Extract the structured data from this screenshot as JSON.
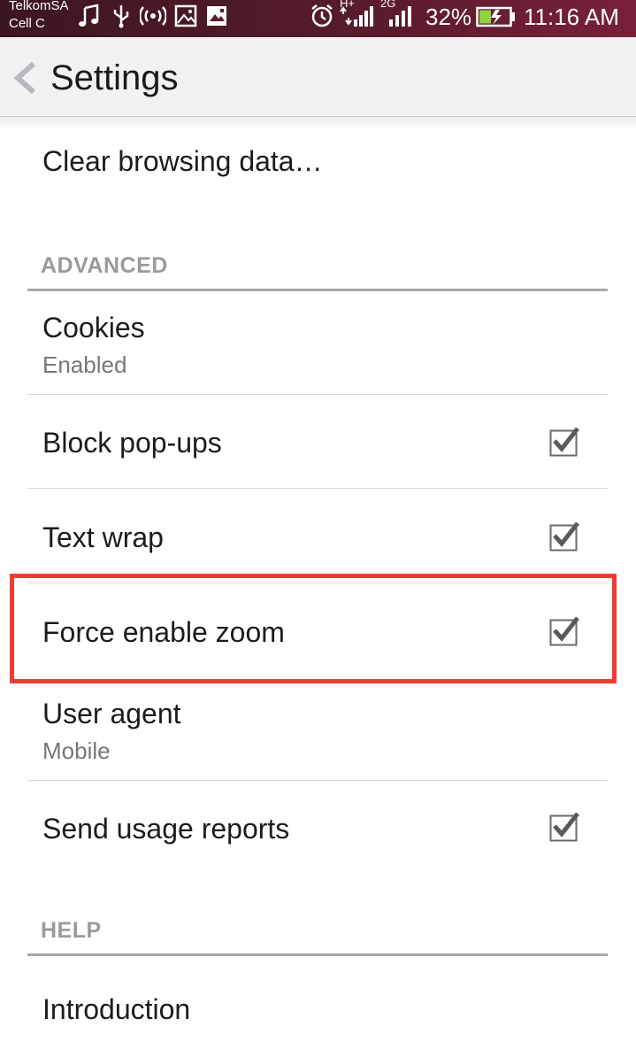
{
  "status_bar": {
    "carrier_1": "TelkomSA",
    "carrier_2": "Cell C",
    "network_label_1": "H+",
    "network_label_2": "2G",
    "battery_percent": "32%",
    "time": "11:16 AM",
    "icons": [
      "music-icon",
      "usb-icon",
      "hotspot-icon",
      "image-icon",
      "gallery-icon",
      "alarm-icon",
      "signal-icon",
      "battery-charging-icon"
    ]
  },
  "action_bar": {
    "title": "Settings"
  },
  "list": {
    "clear_browsing_data": "Clear browsing data…",
    "advanced_header": "ADVANCED",
    "cookies_title": "Cookies",
    "cookies_sub": "Enabled",
    "block_popups": "Block pop-ups",
    "block_popups_checked": true,
    "text_wrap": "Text wrap",
    "text_wrap_checked": true,
    "force_enable_zoom": "Force enable zoom",
    "force_enable_zoom_checked": true,
    "user_agent_title": "User agent",
    "user_agent_sub": "Mobile",
    "send_usage_reports": "Send usage reports",
    "send_usage_reports_checked": true,
    "help_header": "HELP",
    "introduction": "Introduction"
  },
  "colors": {
    "highlight": "#f03a33",
    "statusbar": "#5a1c2c"
  }
}
